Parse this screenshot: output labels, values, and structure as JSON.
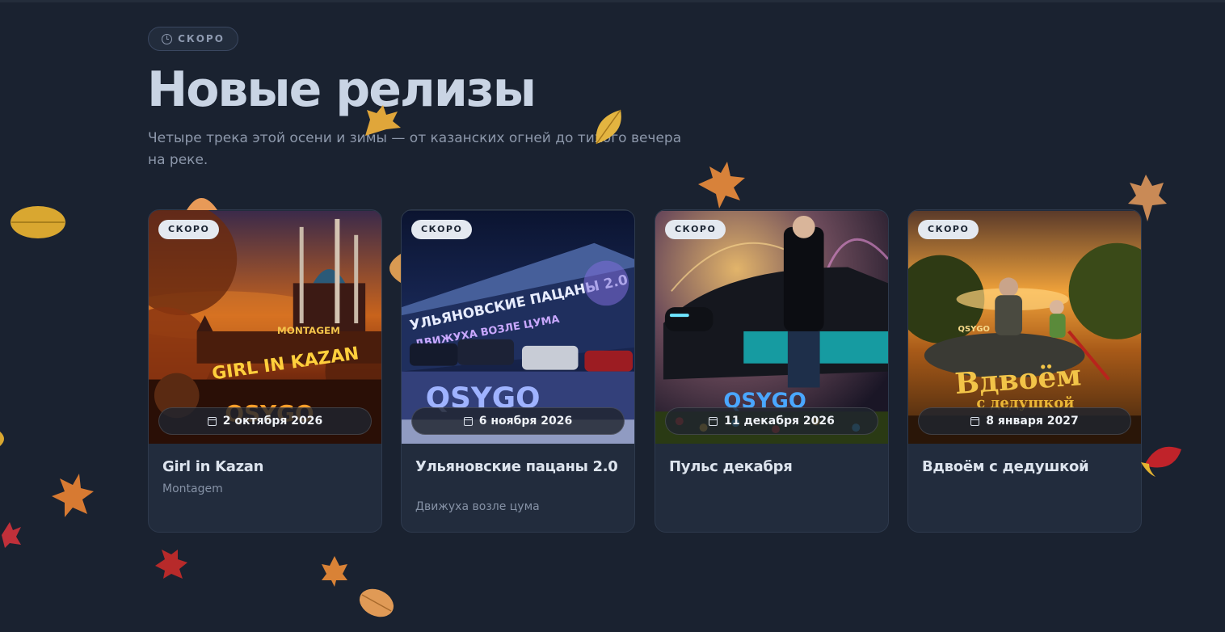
{
  "section": {
    "badge_label": "СКОРО",
    "title": "Новые релизы",
    "subtitle": "Четыре трека этой осени и зимы — от казанских огней до тихого вечера на реке."
  },
  "releases": [
    {
      "badge": "СКОРО",
      "date": "2 октября 2026",
      "title": "Girl in Kazan",
      "subtitle": "Montagem",
      "cover_text": [
        "MONTAGEM",
        "GIRL IN KAZAN",
        "QSYGO"
      ]
    },
    {
      "badge": "СКОРО",
      "date": "6 ноября 2026",
      "title": "Ульяновские пацаны 2.0",
      "subtitle": "Движуха возле цума",
      "cover_text": [
        "УЛЬЯНОВСКИЕ ПАЦАНЫ 2.0",
        "ДВИЖУХА ВОЗЛЕ ЦУМА",
        "QSYGO"
      ]
    },
    {
      "badge": "СКОРО",
      "date": "11 декабря 2026",
      "title": "Пульс декабря",
      "subtitle": "",
      "cover_text": [
        "QSYGO"
      ]
    },
    {
      "badge": "СКОРО",
      "date": "8 января 2027",
      "title": "Вдвоём с дедушкой",
      "subtitle": "",
      "cover_text": [
        "QSYGO",
        "Вдвоём",
        "с дедушкой"
      ]
    }
  ],
  "icons": {
    "badge_icon": "clock-icon",
    "date_icon": "calendar-icon",
    "decoration": "leaf-icon"
  },
  "colors": {
    "background": "#1a2230",
    "card": "#222c3d",
    "title": "#c9d4e4",
    "muted": "#8d98ab",
    "badge_bg": "#e4e9f0"
  }
}
